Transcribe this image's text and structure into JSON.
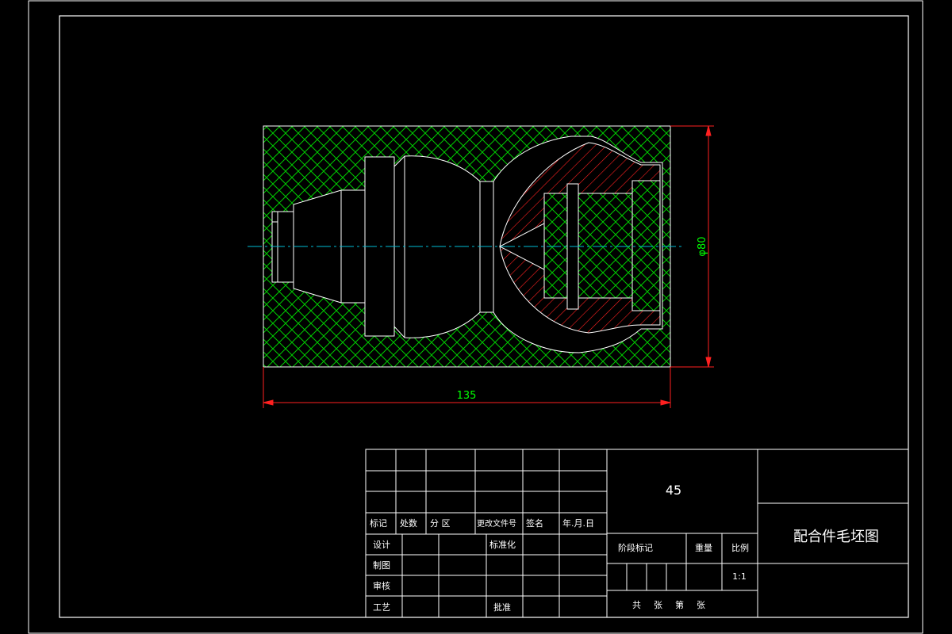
{
  "colors": {
    "background": "#000000",
    "lines": "#ffffff",
    "hatch_stock": "#00cc00",
    "hatch_section": "#ff2020",
    "dimension": "#ff2020",
    "dimension_text": "#00ff00",
    "centerline": "#00bcd4"
  },
  "dimensions": {
    "length": "135",
    "diameter": "φ80"
  },
  "title_block": {
    "material": "45",
    "drawing_title": "配合件毛坯图",
    "headers": {
      "mark": "标记",
      "count": "处数",
      "zone": "分 区",
      "change_doc": "更改文件号",
      "signature": "签名",
      "date": "年.月.日"
    },
    "rows": {
      "design": "设计",
      "standardize": "标准化",
      "drafting": "制图",
      "review": "审核",
      "process": "工艺",
      "approve": "批准"
    },
    "stage_mark": "阶段标记",
    "weight": "重量",
    "scale_label": "比例",
    "scale": "1:1",
    "sheets": {
      "total": "共",
      "sheet_unit_1": "张",
      "page": "第",
      "sheet_unit_2": "张"
    }
  }
}
